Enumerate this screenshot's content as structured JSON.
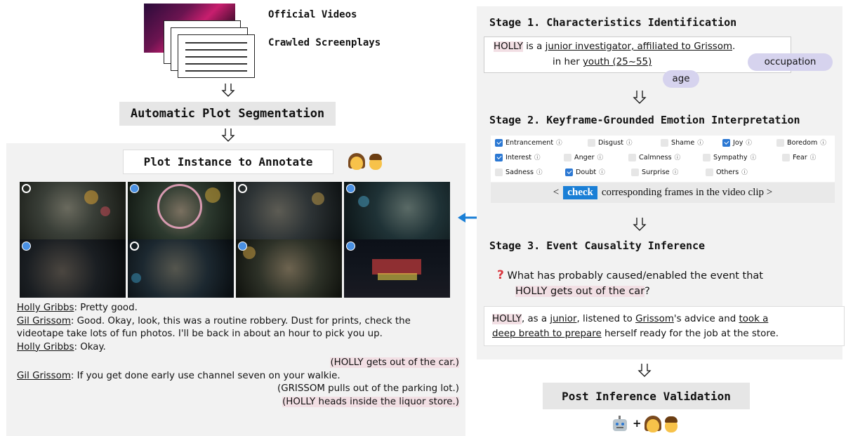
{
  "sources": {
    "video_label": "Official Videos",
    "screenplay_label": "Crawled Screenplays"
  },
  "segmentation": {
    "label": "Automatic Plot Segmentation"
  },
  "plot_panel": {
    "title": "Plot Instance to Annotate",
    "frames": [
      {
        "checked": false,
        "tone": "#3a3f38"
      },
      {
        "checked": true,
        "tone": "#2d3a2f",
        "highlighted": true
      },
      {
        "checked": false,
        "tone": "#2e3436"
      },
      {
        "checked": true,
        "tone": "#1f3236"
      },
      {
        "checked": true,
        "tone": "#1a1e22"
      },
      {
        "checked": false,
        "tone": "#1c2830"
      },
      {
        "checked": true,
        "tone": "#2e3228"
      },
      {
        "checked": true,
        "tone": "#12161e"
      }
    ]
  },
  "transcript": {
    "l1_speaker": "Holly Gribbs",
    "l1_text": ": Pretty good.",
    "l2_speaker": "Gil Grissom",
    "l2_text": ": Good. Okay, look, this was a routine robbery. Dust for prints, check the videotape take lots of fun photos. I'll be back in about an hour to pick you up.",
    "l3_speaker": "Holly Gribbs",
    "l3_text": ": Okay.",
    "action1": "(HOLLY gets out of the car.)",
    "l4_speaker": "Gil Grissom",
    "l4_text": ": If you get done early use channel seven on your walkie.",
    "action2": "(GRISSOM pulls out of the parking lot.)",
    "action3": "(HOLLY heads inside the liquor store.)"
  },
  "stage1": {
    "title": "Stage 1. Characteristics Identification",
    "name": "HOLLY",
    "is_a": " is a ",
    "occupation_text": "junior investigator, affiliated to Grissom",
    "line2_prefix": "in her ",
    "age_text": "youth (25~55)",
    "occupation_tag": "occupation",
    "age_tag": "age"
  },
  "stage2": {
    "title": "Stage 2. Keyframe-Grounded Emotion Interpretation",
    "emotions": [
      {
        "label": "Entrancement",
        "checked": true
      },
      {
        "label": "Disgust",
        "checked": false
      },
      {
        "label": "Shame",
        "checked": false
      },
      {
        "label": "Joy",
        "checked": true
      },
      {
        "label": "Boredom",
        "checked": false
      },
      {
        "label": "Interest",
        "checked": true
      },
      {
        "label": "Anger",
        "checked": false
      },
      {
        "label": "Calmness",
        "checked": false
      },
      {
        "label": "Sympathy",
        "checked": false
      },
      {
        "label": "Fear",
        "checked": false
      },
      {
        "label": "Sadness",
        "checked": false
      },
      {
        "label": "Doubt",
        "checked": true
      },
      {
        "label": "Surprise",
        "checked": false
      },
      {
        "label": "Others",
        "checked": false
      }
    ],
    "check_prefix": "<",
    "check_word": "check",
    "check_suffix": "corresponding frames in the video clip >",
    "info_glyph": "ⓘ"
  },
  "stage3": {
    "title": "Stage 3. Event Causality Inference",
    "question_mark": "?",
    "question": "What has probably caused/enabled the event that",
    "event": "HOLLY gets out of the car",
    "event_q": "?",
    "ans_name": "HOLLY",
    "ans_t1": ", as a ",
    "ans_junior": "junior",
    "ans_t2": ", listened to ",
    "ans_grissom": "Grissom",
    "ans_t3": "'s advice and ",
    "ans_took": "took a",
    "ans_deep": "deep breath to prepare",
    "ans_t4": " herself ready for the job at the store."
  },
  "validation": {
    "label": "Post Inference Validation",
    "plus": "+"
  },
  "colors": {
    "highlight": "#f2dfe4",
    "panel_bg": "#f2f2f2",
    "check_blue": "#2b78d3",
    "arrow_blue": "#1a7fd6",
    "bubble": "#d6d3ee"
  }
}
